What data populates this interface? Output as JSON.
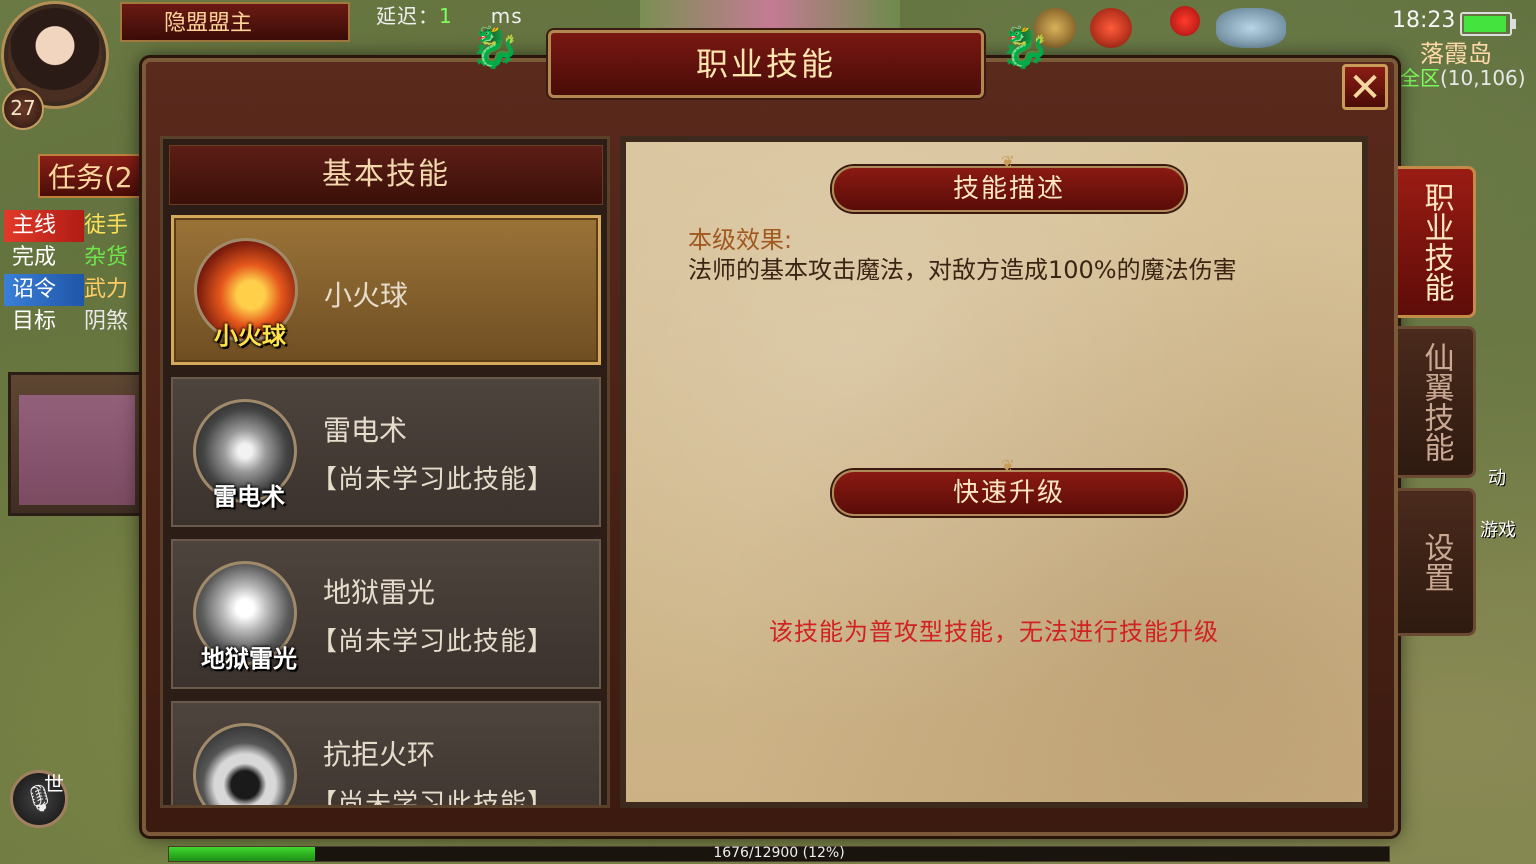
{
  "hud": {
    "guild_title": "隐盟盟主",
    "latency_label": "延迟：",
    "latency_value": "1",
    "latency_unit": "ms",
    "player_level": "27",
    "quest_tab": "任务(2",
    "quests": [
      {
        "type": "主线",
        "text": "徒手",
        "type_color": "red",
        "text_color": "yellow"
      },
      {
        "type": "完成",
        "text": "杂货",
        "type_color": "none",
        "text_color": "green"
      },
      {
        "type": "诏令",
        "text": "武力",
        "type_color": "blue",
        "text_color": "gold"
      },
      {
        "type": "目标",
        "text": "阴煞",
        "type_color": "none",
        "text_color": "white"
      }
    ],
    "clock": "18:23",
    "map_name": "落霞岛",
    "map_zone": "全区",
    "map_coords": "(10,106)",
    "voice_label": "世",
    "right_labels": [
      "动",
      "游戏"
    ],
    "exp_text": "1676/12900 (12%)",
    "exp_progress": 0.12
  },
  "dialog": {
    "title": "职业技能",
    "close_glyph": "✕",
    "skill_list_header": "基本技能",
    "skills": [
      {
        "name": "小火球",
        "icon_label": "小火球",
        "status": "",
        "selected": true,
        "icon": "fireball-icon"
      },
      {
        "name": "雷电术",
        "icon_label": "雷电术",
        "status": "【尚未学习此技能】",
        "selected": false,
        "icon": "thunder-icon"
      },
      {
        "name": "地狱雷光",
        "icon_label": "地狱雷光",
        "status": "【尚未学习此技能】",
        "selected": false,
        "icon": "hell-lightning-icon"
      },
      {
        "name": "抗拒火环",
        "icon_label": "",
        "status": "【尚未学习此技能】",
        "selected": false,
        "icon": "fire-ring-icon"
      }
    ],
    "description_header": "技能描述",
    "effect_label": "本级效果:",
    "effect_text": "法师的基本攻击魔法，对敌方造成100%的魔法伤害",
    "upgrade_header": "快速升级",
    "upgrade_note": "该技能为普攻型技能，无法进行技能升级",
    "side_tabs": [
      {
        "label": "职业技能",
        "active": true
      },
      {
        "label": "仙翼技能",
        "active": false
      },
      {
        "label": "设置",
        "active": false
      }
    ]
  }
}
